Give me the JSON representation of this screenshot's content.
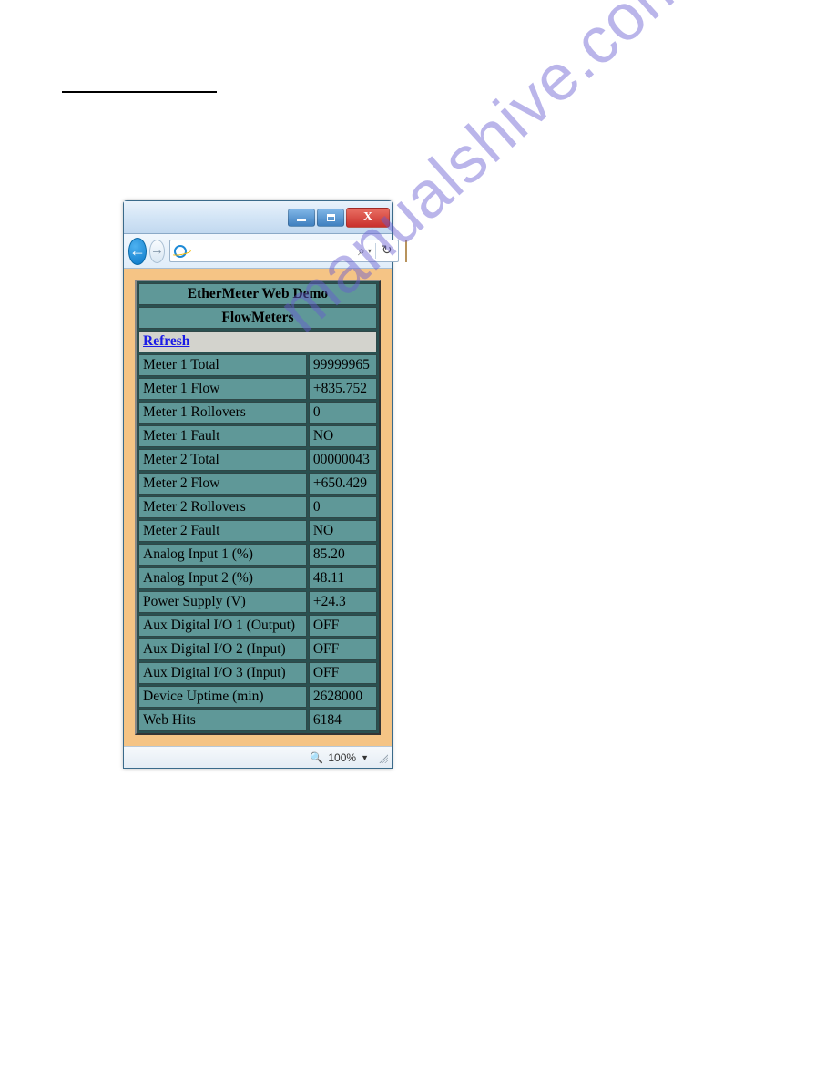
{
  "titlebar": {
    "close_glyph": "X"
  },
  "toolbar": {
    "address_value": "",
    "search_glyph": "⌕",
    "dropdown_glyph": "▾",
    "refresh_glyph": "↻",
    "back_glyph": "←",
    "fwd_glyph": "→"
  },
  "page": {
    "title": "EtherMeter Web Demo",
    "subtitle": "FlowMeters",
    "refresh_label": "Refresh",
    "rows": [
      {
        "label": "Meter 1 Total",
        "value": "99999965"
      },
      {
        "label": "Meter 1 Flow",
        "value": "+835.752"
      },
      {
        "label": "Meter 1 Rollovers",
        "value": "0"
      },
      {
        "label": "Meter 1 Fault",
        "value": "NO"
      },
      {
        "label": "Meter 2 Total",
        "value": "00000043"
      },
      {
        "label": "Meter 2 Flow",
        "value": "+650.429"
      },
      {
        "label": "Meter 2 Rollovers",
        "value": "0"
      },
      {
        "label": "Meter 2 Fault",
        "value": "NO"
      },
      {
        "label": "Analog Input 1 (%)",
        "value": "85.20"
      },
      {
        "label": "Analog Input 2 (%)",
        "value": "48.11"
      },
      {
        "label": "Power Supply (V)",
        "value": "+24.3"
      },
      {
        "label": "Aux Digital I/O 1 (Output)",
        "value": "OFF"
      },
      {
        "label": "Aux Digital I/O 2 (Input)",
        "value": "OFF"
      },
      {
        "label": "Aux Digital I/O 3 (Input)",
        "value": "OFF"
      },
      {
        "label": "Device Uptime (min)",
        "value": "2628000"
      },
      {
        "label": "Web Hits",
        "value": "6184"
      }
    ]
  },
  "statusbar": {
    "zoom_mag": "🔍",
    "zoom_text": "100%",
    "zoom_arrow": "▼"
  },
  "watermark": "manualshive.com"
}
